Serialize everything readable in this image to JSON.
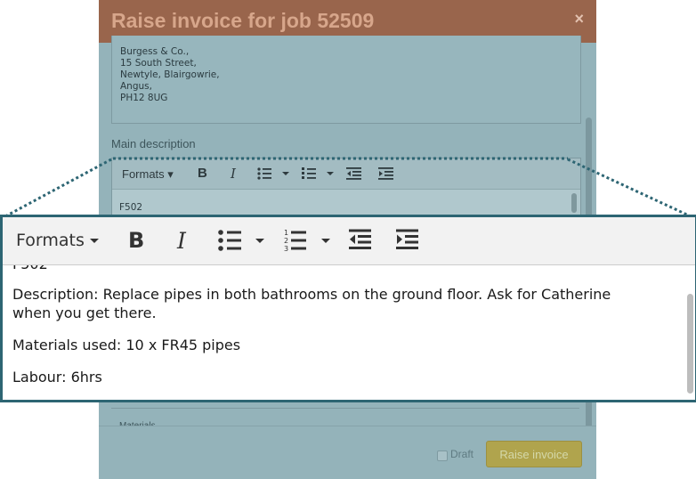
{
  "modal": {
    "title": "Raise invoice for job 52509",
    "close": "×",
    "address_lines": [
      "Burgess & Co.,",
      "15 South Street,",
      "Newtyle, Blairgowrie,",
      "Angus,",
      "PH12 8UG"
    ],
    "main_description_label": "Main description",
    "editor_preview_text": "F502",
    "materials_label": "Materials",
    "draft_label": "Draft",
    "raise_button": "Raise invoice",
    "accent_colors": {
      "header": "#99654c",
      "button": "#b0a44d",
      "overlay": "#94b3ba"
    }
  },
  "toolbar": {
    "formats_label": "Formats",
    "bold": "B",
    "italic": "I",
    "icons": [
      "caret-down-icon",
      "bold-icon",
      "italic-icon",
      "bullet-list-icon",
      "numbered-list-icon",
      "outdent-icon",
      "indent-icon"
    ]
  },
  "editor": {
    "cut_line": "F502",
    "description": "Description: Replace pipes in both bathrooms on the ground floor. Ask for Catherine when you get there.",
    "materials": "Materials used: 10 x FR45 pipes",
    "labour": "Labour: 6hrs"
  },
  "zoom_callout": {
    "border_color": "#2d6573"
  }
}
